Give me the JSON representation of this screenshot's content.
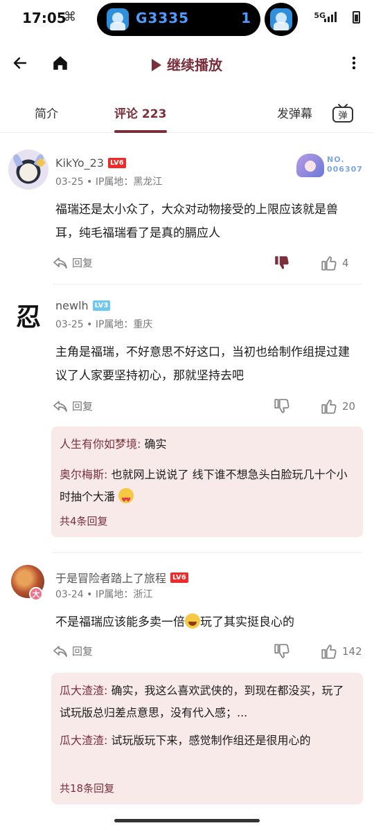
{
  "status_bar": {
    "time": "17:05",
    "network_glyph": "⌘",
    "island_label": "G3335",
    "island_count": "1",
    "network_type": "5G"
  },
  "app_bar": {
    "continue_label": "继续播放"
  },
  "tabs": {
    "intro": "简介",
    "comments": "评论 223",
    "send_danmaku": "发弹幕",
    "danmaku_toggle": "弹"
  },
  "comments": [
    {
      "username": "KikYo_23",
      "level": "LV6",
      "date_location": "03-25 • IP属地：黑龙江",
      "text": "福瑞还是太小众了，大众对动物接受的上限应该就是兽耳，纯毛福瑞看了是真的膈应人",
      "reply_label": "回复",
      "likes": "4",
      "fan_badge": "NO.\n006307"
    },
    {
      "username": "newlh",
      "level": "LV3",
      "avatar_char": "忍",
      "date_location": "03-25 • IP属地：重庆",
      "text": "主角是福瑞，不好意思不好这口，当初也给制作组提过建议了人家要坚持初心，那就坚持去吧",
      "reply_label": "回复",
      "likes": "20",
      "replies": [
        {
          "name": "人生有你如梦境:",
          "text": " 确实"
        },
        {
          "name": "奥尔梅斯:",
          "text": " 也就网上说说了 线下谁不想急头白脸玩几十个小时抽个大潘"
        }
      ],
      "more_replies": "共4条回复"
    },
    {
      "username": "于是冒险者踏上了旅程",
      "level": "LV6",
      "avatar_badge": "大",
      "date_location": "03-24 • IP属地：浙江",
      "text_before": "不是福瑞应该能多卖一倍",
      "text_after": "玩了其实挺良心的",
      "reply_label": "回复",
      "likes": "142",
      "replies": [
        {
          "name": "瓜大渣渣:",
          "text": " 确实，我这么喜欢武侠的，到现在都没买，玩了试玩版总归差点意思，没有代入感；..."
        },
        {
          "name": "瓜大渣渣:",
          "text": " 试玩版玩下来，感觉制作组还是很用心的"
        }
      ],
      "more_replies": "共18条回复"
    }
  ],
  "colors": {
    "accent": "#7a2f3b",
    "reply_bg": "#f9eaea",
    "lv6": "#ee2a2a",
    "lv3": "#6fc8ef"
  }
}
